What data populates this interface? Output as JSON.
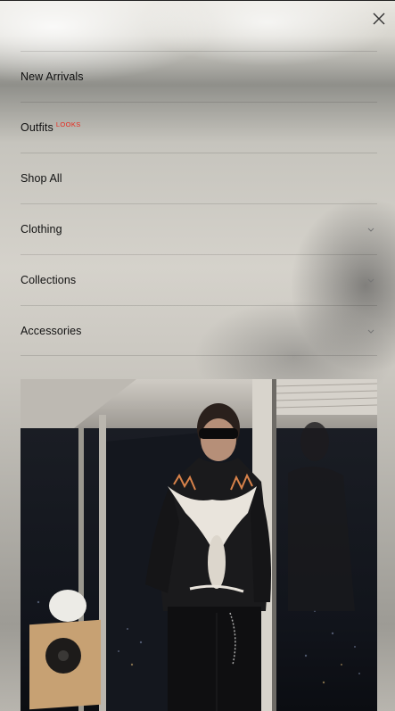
{
  "menu": {
    "close_label": "Close",
    "items": [
      {
        "label": "New Arrivals",
        "badge": "",
        "has_submenu": false
      },
      {
        "label": "Outfits",
        "badge": "LOOKS",
        "has_submenu": false
      },
      {
        "label": "Shop All",
        "badge": "",
        "has_submenu": false
      },
      {
        "label": "Clothing",
        "badge": "",
        "has_submenu": true
      },
      {
        "label": "Collections",
        "badge": "",
        "has_submenu": true
      },
      {
        "label": "Accessories",
        "badge": "",
        "has_submenu": true
      }
    ]
  },
  "colors": {
    "badge": "#e8281c",
    "text": "#111111",
    "divider": "rgba(0,0,0,0.12)"
  },
  "icons": {
    "close": "close-icon",
    "expand": "chevron-down-icon"
  }
}
